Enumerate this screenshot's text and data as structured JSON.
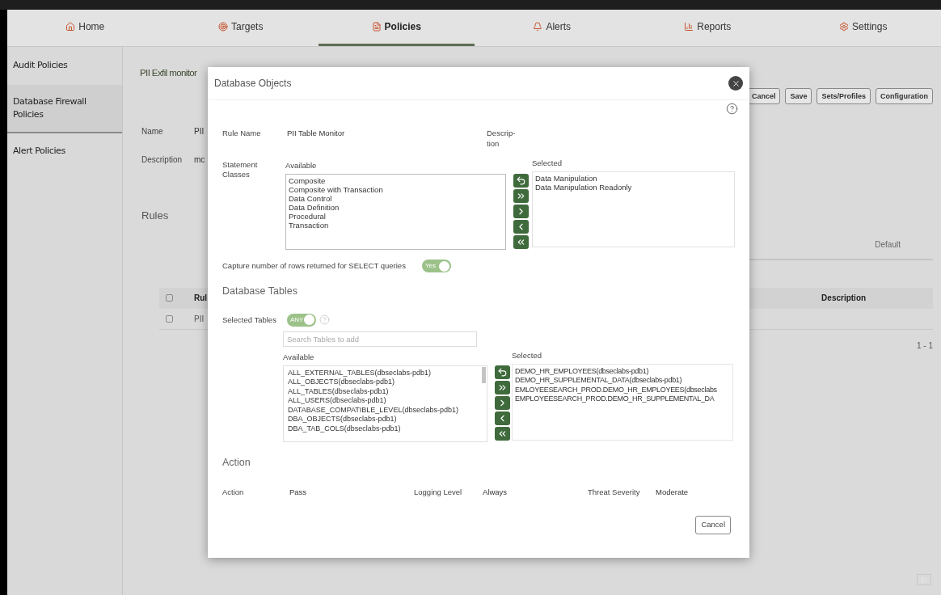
{
  "nav": {
    "tabs": [
      {
        "label": "Home",
        "kind": "home",
        "selected": false
      },
      {
        "label": "Targets",
        "kind": "target",
        "selected": false
      },
      {
        "label": "Policies",
        "kind": "document",
        "selected": true
      },
      {
        "label": "Alerts",
        "kind": "bell",
        "selected": false
      },
      {
        "label": "Reports",
        "kind": "chart",
        "selected": false
      },
      {
        "label": "Settings",
        "kind": "gear",
        "selected": false
      }
    ]
  },
  "sidebar": {
    "items": [
      {
        "label": "Audit Policies",
        "selected": false
      },
      {
        "label": "Database Firewall Policies",
        "selected": true
      },
      {
        "label": "Alert Policies",
        "selected": false
      }
    ]
  },
  "page": {
    "title": "PII Exfil monitor",
    "buttons": [
      "Cancel",
      "Save",
      "Sets/Profiles",
      "Configuration"
    ],
    "fields": [
      {
        "label": "Name",
        "value": "PII"
      },
      {
        "label": "Description",
        "value": "mc"
      }
    ],
    "rules_heading": "Rules",
    "tab": "Default",
    "table": {
      "columns": [
        "Rul",
        "Description"
      ],
      "header_checked": false,
      "rows": [
        {
          "cells": [
            "PII"
          ],
          "checked": false
        }
      ],
      "pagination": "1 - 1"
    }
  },
  "modal": {
    "title": "Database Objects",
    "rule_name": {
      "label": "Rule Name",
      "value": "PII Table Monitor"
    },
    "description_label": "Descrip-tion",
    "statement_classes": {
      "label": "Statement Classes",
      "available_label": "Available",
      "selected_label": "Selected",
      "available": [
        "Composite",
        "Composite with Transaction",
        "Data Control",
        "Data Definition",
        "Procedural",
        "Transaction"
      ],
      "selected": [
        "Data Manipulation",
        "Data Manipulation Readonly"
      ]
    },
    "capture": {
      "label": "Capture number of rows returned for SELECT queries",
      "toggle": {
        "label": "Yes",
        "on": true
      }
    },
    "tables": {
      "heading": "Database Tables",
      "label": "Selected Tables",
      "toggle": {
        "label": "ANY",
        "on": true
      },
      "search": {
        "placeholder": "Search Tables to add"
      },
      "available_label": "Available",
      "selected_label": "Selected",
      "available": [
        "ALL_EXTERNAL_TABLES(dbseclabs-pdb1)",
        "ALL_OBJECTS(dbseclabs-pdb1)",
        "ALL_TABLES(dbseclabs-pdb1)",
        "ALL_USERS(dbseclabs-pdb1)",
        "DATABASE_COMPATIBLE_LEVEL(dbseclabs-pdb1)",
        "DBA_OBJECTS(dbseclabs-pdb1)",
        "DBA_TAB_COLS(dbseclabs-pdb1)"
      ],
      "selected": [
        "DEMO_HR_EMPLOYEES(dbseclabs-pdb1)",
        "DEMO_HR_SUPPLEMENTAL_DATA(dbseclabs-pdb1)",
        "EMLOYEESEARCH_PROD.DEMO_HR_EMPLOYEES(dbseclabs",
        "EMPLOYEESEARCH_PROD.DEMO_HR_SUPPLEMENTAL_DA"
      ]
    },
    "action": {
      "heading": "Action",
      "fields": [
        {
          "label": "Action",
          "value": "Pass"
        },
        {
          "label": "Logging Level",
          "value": "Always"
        },
        {
          "label": "Threat Severity",
          "value": "Moderate"
        }
      ]
    },
    "cancel": "Cancel"
  }
}
